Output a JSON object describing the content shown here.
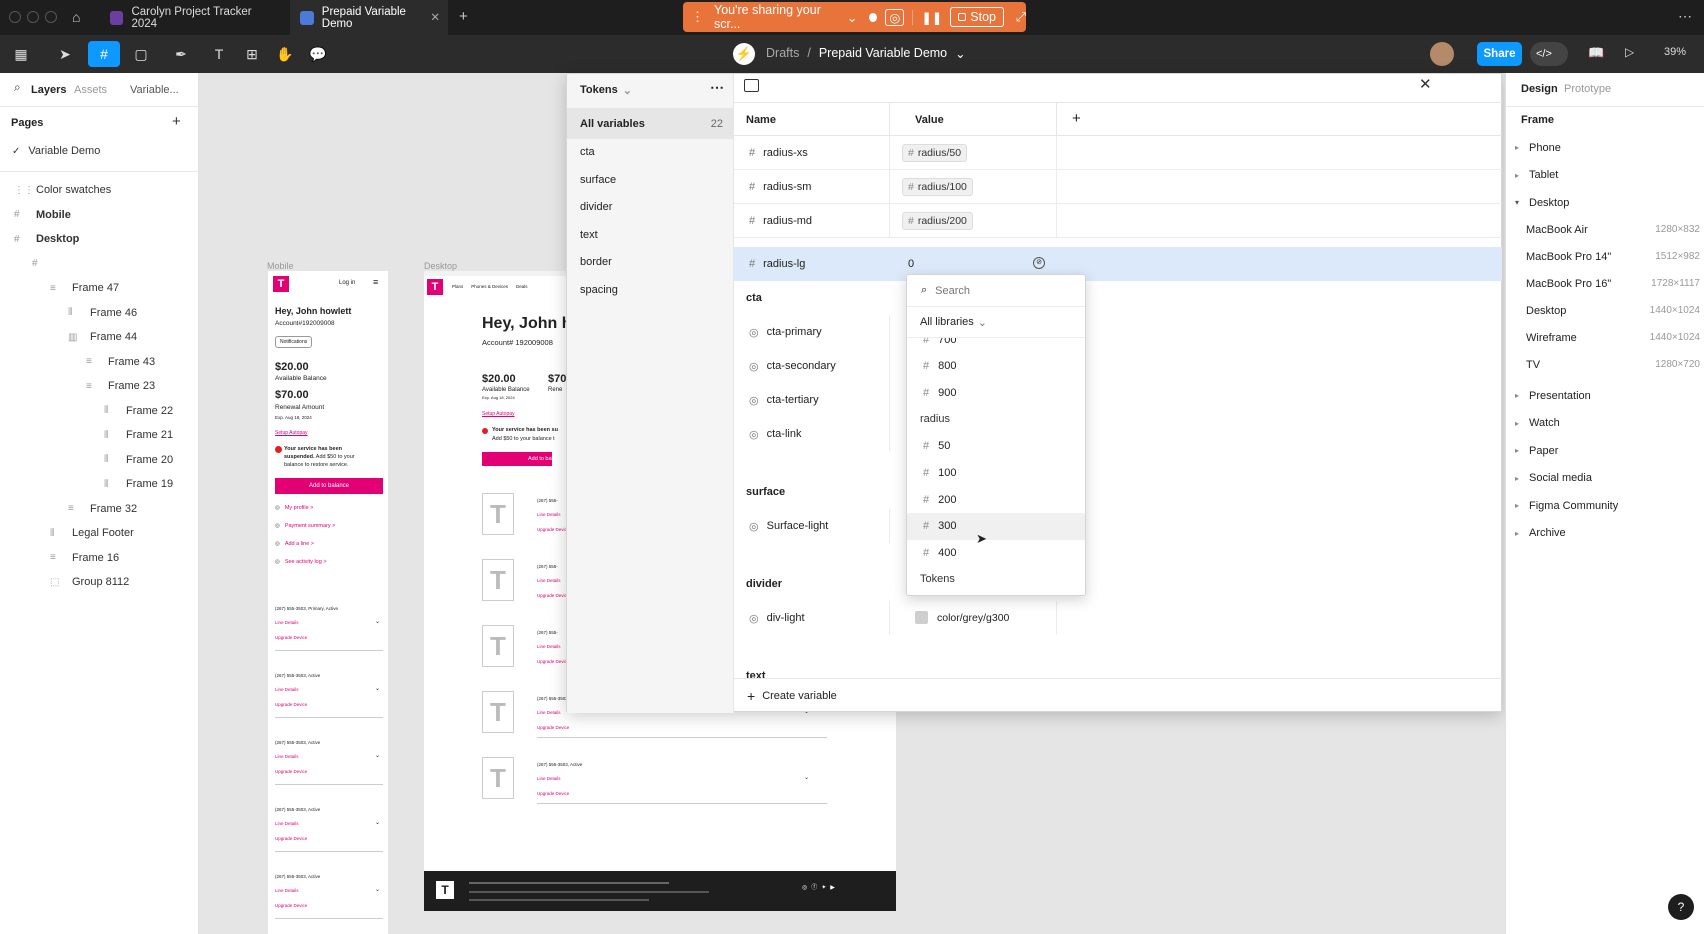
{
  "tabs": {
    "tab1": "Carolyn Project Tracker 2024",
    "tab2": "Prepaid Variable Demo"
  },
  "share": {
    "text": "You're sharing your scr...",
    "stop": "Stop"
  },
  "toolbar": {
    "breadcrumb_root": "Drafts",
    "breadcrumb_sep": "/",
    "file_name": "Prepaid Variable Demo",
    "share_label": "Share",
    "zoom": "39%"
  },
  "left": {
    "tabs": {
      "layers": "Layers",
      "assets": "Assets",
      "variables": "Variable..."
    },
    "pages_title": "Pages",
    "pages": [
      "Variable Demo"
    ],
    "layers": [
      {
        "label": "Color swatches",
        "indent": 0,
        "icon": "grid-icon",
        "bold": false
      },
      {
        "label": "Mobile",
        "indent": 0,
        "icon": "frame-icon",
        "bold": true
      },
      {
        "label": "Desktop",
        "indent": 0,
        "icon": "frame-icon",
        "bold": true
      },
      {
        "label": "",
        "indent": 1,
        "icon": "frame-icon",
        "bold": false
      },
      {
        "label": "Frame 47",
        "indent": 2,
        "icon": "rows-icon",
        "bold": false
      },
      {
        "label": "Frame 46",
        "indent": 3,
        "icon": "columns-icon",
        "bold": false
      },
      {
        "label": "Frame 44",
        "indent": 3,
        "icon": "bars-icon",
        "bold": false
      },
      {
        "label": "Frame 43",
        "indent": 4,
        "icon": "rows-icon",
        "bold": false
      },
      {
        "label": "Frame 23",
        "indent": 4,
        "icon": "rows-icon",
        "bold": false
      },
      {
        "label": "Frame 22",
        "indent": 5,
        "icon": "columns-icon",
        "bold": false
      },
      {
        "label": "Frame 21",
        "indent": 5,
        "icon": "columns-icon",
        "bold": false
      },
      {
        "label": "Frame 20",
        "indent": 5,
        "icon": "columns-icon",
        "bold": false
      },
      {
        "label": "Frame 19",
        "indent": 5,
        "icon": "columns-icon",
        "bold": false
      },
      {
        "label": "Frame 32",
        "indent": 3,
        "icon": "rows-icon",
        "bold": false
      },
      {
        "label": "Legal Footer",
        "indent": 2,
        "icon": "columns-icon",
        "bold": false
      },
      {
        "label": "Frame 16",
        "indent": 2,
        "icon": "rows-icon",
        "bold": false
      },
      {
        "label": "Group 8112",
        "indent": 2,
        "icon": "group-icon",
        "bold": false
      }
    ]
  },
  "canvas": {
    "mobile_label": "Mobile",
    "desktop_label": "Desktop",
    "mobile": {
      "login": "Log in",
      "greeting": "Hey, John howlett",
      "account": "Account#192009008",
      "notifications": "Notifications",
      "balance": "$20.00",
      "balance_label": "Available Balance",
      "renewal": "$70.00",
      "renewal_label": "Renewal Amount",
      "exp": "Exp. Aug 18, 2024",
      "autopay": "Setup Autopay",
      "alert_bold": "Your service has been suspended.",
      "alert_rest": "Add $50 to your balance to restore service.",
      "add_btn": "Add to balance",
      "links": [
        "My profile >",
        "Payment summary >",
        "Add a line >",
        "See activity log >"
      ],
      "line_primary": "(267) 555-3503, Primary, Active",
      "line_active": "(267) 555-3503, Active",
      "line_details": "Line Details",
      "upgrade": "Upgrade Device"
    },
    "desktop": {
      "nav": [
        "Plans",
        "Phones & Devices",
        "Deals"
      ],
      "greeting": "Hey, John h",
      "account": "Account# 192009008",
      "balance": "$20.00",
      "balance_label": "Available Balance",
      "exp": "Exp. Aug 18, 2024",
      "renewal_partial": "$70",
      "renewal_label_partial": "Rene",
      "autopay": "Setup Autopay",
      "alert": "Your service has been su",
      "alert2": "Add $50 to your balance t",
      "add_btn": "Add to bala",
      "line_prefix": "(267) 555-",
      "line_active": "(267) 555-3503, Active",
      "line_details": "Line Details",
      "upgrade": "Upgrade Device"
    }
  },
  "modal": {
    "collection": "Tokens",
    "all_variables": "All variables",
    "all_count": "22",
    "groups": [
      "cta",
      "surface",
      "divider",
      "text",
      "border",
      "spacing"
    ],
    "col_name": "Name",
    "col_value": "Value",
    "rows": [
      {
        "name": "radius-xs",
        "value": "radius/50"
      },
      {
        "name": "radius-sm",
        "value": "radius/100"
      },
      {
        "name": "radius-md",
        "value": "radius/200"
      }
    ],
    "active_row": {
      "name": "radius-lg",
      "value": "0"
    },
    "sections": [
      {
        "title": "cta",
        "items": [
          "cta-primary",
          "cta-secondary",
          "cta-tertiary",
          "cta-link"
        ]
      },
      {
        "title": "surface",
        "items": [
          "Surface-light"
        ]
      },
      {
        "title": "divider",
        "items": [
          "div-light"
        ]
      },
      {
        "title": "text",
        "items": []
      }
    ],
    "div_light_value": "color/grey/g300",
    "create_variable": "Create variable"
  },
  "dropdown": {
    "search_placeholder": "Search",
    "libraries": "All libraries",
    "items_top": [
      "700",
      "800",
      "900"
    ],
    "group_radius": "radius",
    "items_radius": [
      "50",
      "100",
      "200",
      "300",
      "400"
    ],
    "group_tokens": "Tokens"
  },
  "right": {
    "tab_design": "Design",
    "tab_prototype": "Prototype",
    "frame_title": "Frame",
    "collapsed_top": [
      "Phone",
      "Tablet"
    ],
    "desktop_group": "Desktop",
    "devices": [
      {
        "name": "MacBook Air",
        "size": "1280×832"
      },
      {
        "name": "MacBook Pro 14\"",
        "size": "1512×982"
      },
      {
        "name": "MacBook Pro 16\"",
        "size": "1728×1117"
      },
      {
        "name": "Desktop",
        "size": "1440×1024"
      },
      {
        "name": "Wireframe",
        "size": "1440×1024"
      },
      {
        "name": "TV",
        "size": "1280×720"
      }
    ],
    "collapsed_bottom": [
      "Presentation",
      "Watch",
      "Paper",
      "Social media",
      "Figma Community",
      "Archive"
    ]
  },
  "colors": {
    "accent": "#0d99ff",
    "brand": "#e20074",
    "share_banner": "#e8743b"
  }
}
